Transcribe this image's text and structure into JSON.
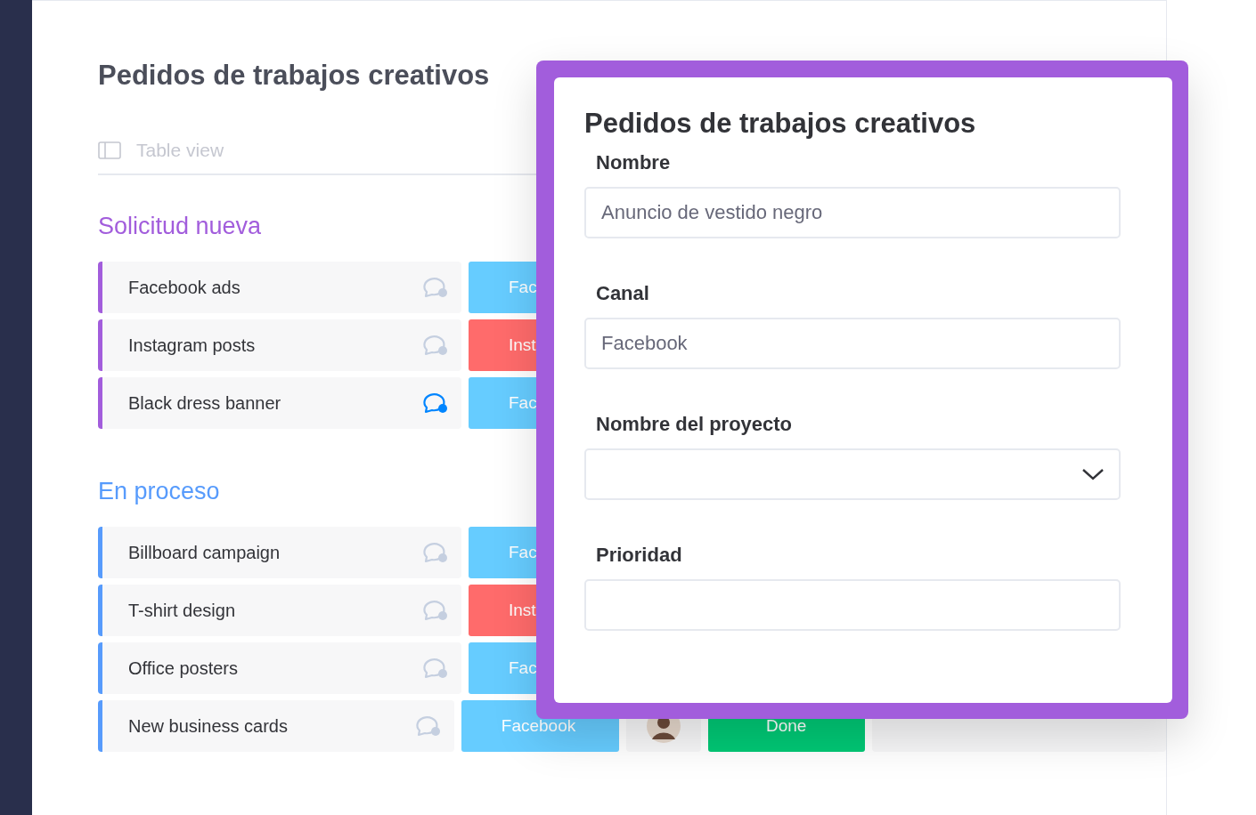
{
  "board": {
    "title": "Pedidos de trabajos creativos",
    "view_tab": "Table view",
    "groups": [
      {
        "title": "Solicitud nueva",
        "color": "#a25ddc",
        "rows": [
          {
            "name": "Facebook ads",
            "comment_active": false,
            "channel": {
              "label": "Fac",
              "color": "#66ccff"
            }
          },
          {
            "name": "Instagram posts",
            "comment_active": false,
            "channel": {
              "label": "Inst",
              "color": "#ff6b6b"
            }
          },
          {
            "name": "Black dress banner",
            "comment_active": true,
            "channel": {
              "label": "Fac",
              "color": "#66ccff"
            }
          }
        ]
      },
      {
        "title": "En proceso",
        "color": "#579bfc",
        "rows": [
          {
            "name": "Billboard campaign",
            "comment_active": false,
            "channel": {
              "label": "Fac",
              "color": "#66ccff"
            }
          },
          {
            "name": "T-shirt design",
            "comment_active": false,
            "channel": {
              "label": "Inst",
              "color": "#ff6b6b"
            }
          },
          {
            "name": "Office posters",
            "comment_active": false,
            "channel": {
              "label": "Fac",
              "color": "#66ccff"
            }
          },
          {
            "name": "New business cards",
            "comment_active": false,
            "channel": {
              "label": "Facebook",
              "color": "#66ccff"
            },
            "has_person": true,
            "status": {
              "label": "Done",
              "color": "#00c875"
            }
          }
        ]
      }
    ]
  },
  "form": {
    "title": "Pedidos de trabajos creativos",
    "fields": [
      {
        "kind": "text",
        "label": "Nombre",
        "value": "Anuncio de vestido negro"
      },
      {
        "kind": "text",
        "label": "Canal",
        "value": "Facebook"
      },
      {
        "kind": "dropdown",
        "label": "Nombre del proyecto"
      },
      {
        "kind": "text",
        "label": "Prioridad"
      }
    ]
  }
}
